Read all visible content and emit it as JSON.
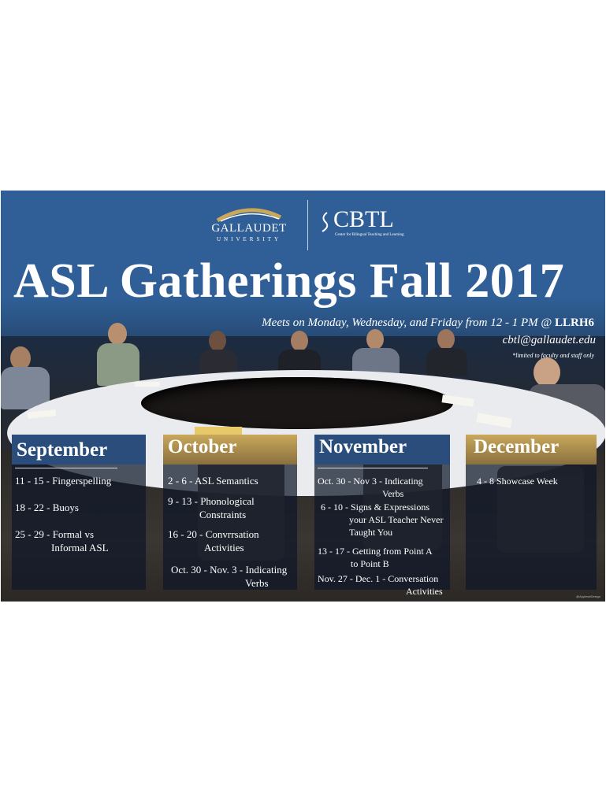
{
  "logos": {
    "university_name": "GALLAUDET",
    "university_sub": "UNIVERSITY",
    "center_name": "CBTL",
    "center_sub": "Center for Bilingual Teaching and Learning"
  },
  "title": "ASL Gatherings Fall 2017",
  "meets_prefix": "Meets on Monday, Wednesday, and Friday from 12 - 1 PM @",
  "meets_location": "LLRH6",
  "email": "cbtl@gallaudet.edu",
  "note": "*limited to faculty and staff only",
  "months": {
    "september": {
      "name": "September",
      "items": [
        {
          "dates": "11 - 15",
          "topic": "Fingerspelling"
        },
        {
          "dates": "18 - 22",
          "topic": "Buoys"
        },
        {
          "dates": "25 - 29",
          "topic": "Formal vs",
          "topic2": "Informal ASL"
        }
      ]
    },
    "october": {
      "name": "October",
      "items": [
        {
          "dates": "2 - 6",
          "topic": "ASL Semantics"
        },
        {
          "dates": "9 - 13",
          "topic": "Phonological",
          "topic2": "Constraints"
        },
        {
          "dates": "16 - 20",
          "topic": "Convrrsation",
          "topic2": "Activities"
        },
        {
          "dates": "Oct. 30 - Nov. 3",
          "topic": "Indicating",
          "topic2": "Verbs"
        }
      ]
    },
    "november": {
      "name": "November",
      "items": [
        {
          "dates": "Oct. 30 - Nov 3",
          "topic": "Indicating",
          "topic2": "Verbs"
        },
        {
          "dates": "6 - 10",
          "topic": "Signs & Expressions",
          "topic2": "your ASL Teacher Never",
          "topic3": "Taught You"
        },
        {
          "dates": "13 - 17",
          "topic": "Getting from Point A",
          "topic2": "to Point B"
        },
        {
          "dates": "Nov. 27 - Dec. 1",
          "topic": "Conversation",
          "topic2": "Activities"
        }
      ]
    },
    "december": {
      "name": "December",
      "items": [
        {
          "dates": "4 - 8",
          "topic": "Showcase Week"
        }
      ]
    }
  },
  "credit": "@AppleseDesign",
  "colors": {
    "background_blue": "#2f5f96",
    "header_blue": "#2a4d7c",
    "header_gold": "#c9a85a",
    "text": "#ffffff"
  }
}
